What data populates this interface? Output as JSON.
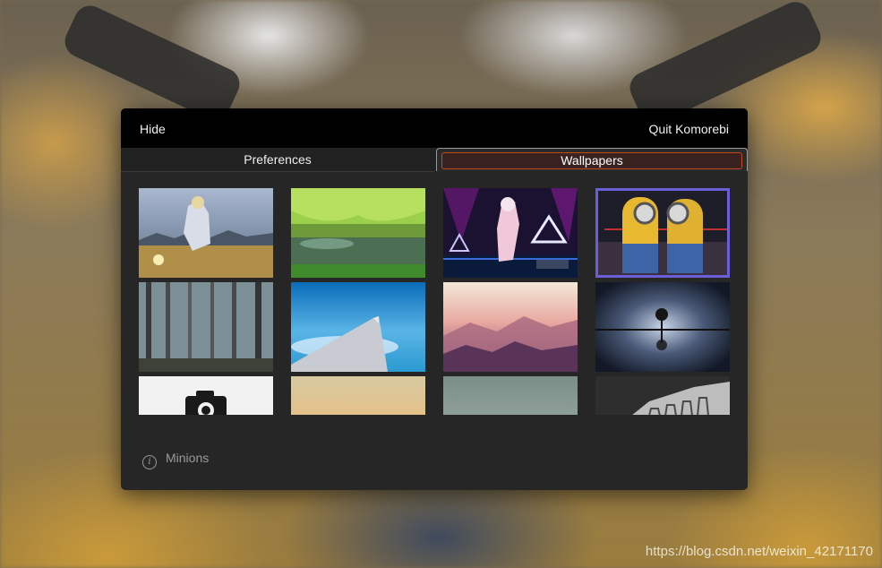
{
  "window": {
    "hide_label": "Hide",
    "quit_label": "Quit Komorebi"
  },
  "tabs": [
    {
      "label": "Preferences",
      "active": false
    },
    {
      "label": "Wallpapers",
      "active": true
    }
  ],
  "wallpapers": [
    {
      "name": "anime-knight-field",
      "selected": false
    },
    {
      "name": "green-forest-lake",
      "selected": false
    },
    {
      "name": "anime-dancer-stage",
      "selected": false
    },
    {
      "name": "minions",
      "selected": true
    },
    {
      "name": "foggy-forest",
      "selected": false
    },
    {
      "name": "airplane-wing",
      "selected": false
    },
    {
      "name": "pink-mountains",
      "selected": false
    },
    {
      "name": "tree-reflection",
      "selected": false
    },
    {
      "name": "camera-icon",
      "selected": false
    },
    {
      "name": "gradient-sand",
      "selected": false
    },
    {
      "name": "gradient-teal",
      "selected": false
    },
    {
      "name": "white-architecture",
      "selected": false
    }
  ],
  "info": {
    "icon": "info-icon",
    "text": "Minions"
  },
  "watermark": "https://blog.csdn.net/weixin_42171170",
  "colors": {
    "selection": "#6a5fd8",
    "active_tab_border": "#c04a1a",
    "window_bg": "#262626",
    "titlebar_bg": "#000000"
  }
}
